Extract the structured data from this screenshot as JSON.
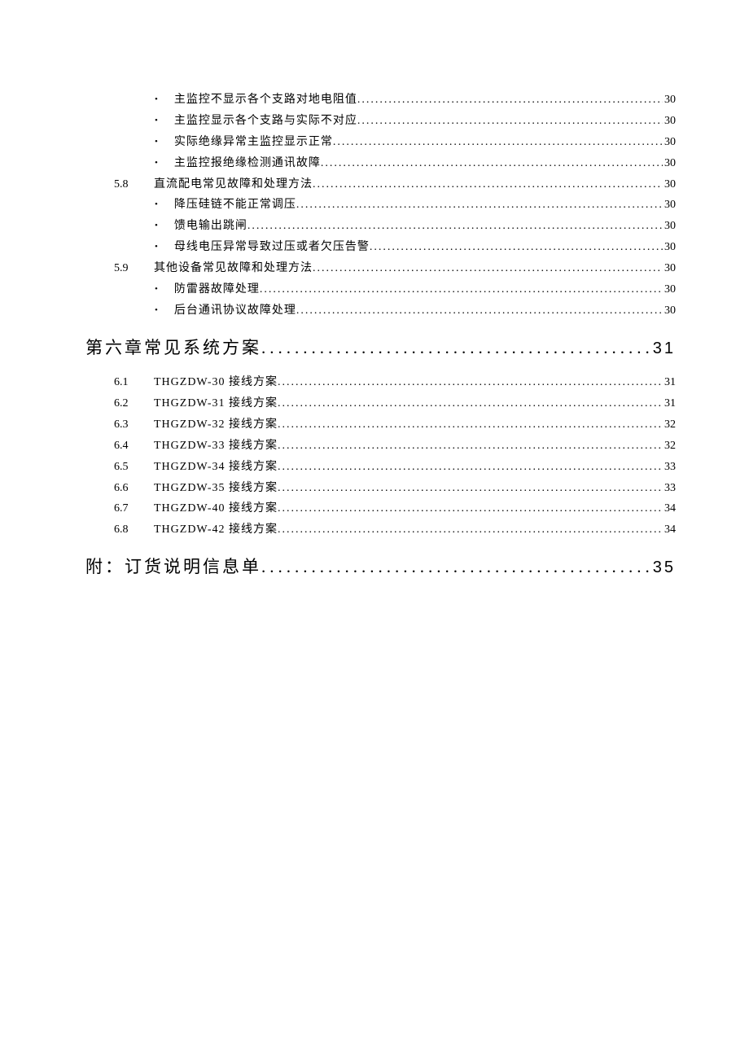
{
  "toc": [
    {
      "type": "bullet",
      "text": "主监控不显示各个支路对地电阻值",
      "page": "30"
    },
    {
      "type": "bullet",
      "text": "主监控显示各个支路与实际不对应",
      "page": "30"
    },
    {
      "type": "bullet",
      "text": "实际绝缘异常主监控显示正常",
      "page": "30"
    },
    {
      "type": "bullet",
      "text": "主监控报绝缘检测通讯故障",
      "page": "30"
    },
    {
      "type": "sec",
      "num": "5.8",
      "text": "直流配电常见故障和处理方法",
      "page": "30"
    },
    {
      "type": "bullet",
      "text": "降压硅链不能正常调压",
      "page": "30"
    },
    {
      "type": "bullet",
      "text": "馈电输出跳闸",
      "page": "30"
    },
    {
      "type": "bullet",
      "text": "母线电压异常导致过压或者欠压告警",
      "page": "30"
    },
    {
      "type": "sec",
      "num": "5.9",
      "text": "其他设备常见故障和处理方法",
      "page": "30"
    },
    {
      "type": "bullet",
      "text": "防雷器故障处理",
      "page": "30"
    },
    {
      "type": "bullet",
      "text": "后台通讯协议故障处理",
      "page": "30"
    },
    {
      "type": "chap",
      "text": "第六章常见系统方案",
      "page": "31"
    },
    {
      "type": "sec",
      "num": "6.1",
      "text": "THGZDW-30 接线方案",
      "page": "31"
    },
    {
      "type": "sec",
      "num": "6.2",
      "text": "THGZDW-31 接线方案",
      "page": "31"
    },
    {
      "type": "sec",
      "num": "6.3",
      "text": "THGZDW-32 接线方案",
      "page": "32"
    },
    {
      "type": "sec",
      "num": "6.4",
      "text": "THGZDW-33 接线方案",
      "page": "32"
    },
    {
      "type": "sec",
      "num": "6.5",
      "text": "THGZDW-34 接线方案",
      "page": "33"
    },
    {
      "type": "sec",
      "num": "6.6",
      "text": "THGZDW-35 接线方案",
      "page": "33"
    },
    {
      "type": "sec",
      "num": "6.7",
      "text": "THGZDW-40 接线方案",
      "page": "34"
    },
    {
      "type": "sec",
      "num": "6.8",
      "text": "THGZDW-42 接线方案",
      "page": "34"
    },
    {
      "type": "chap",
      "text": "附：订货说明信息单",
      "page": "35"
    }
  ]
}
